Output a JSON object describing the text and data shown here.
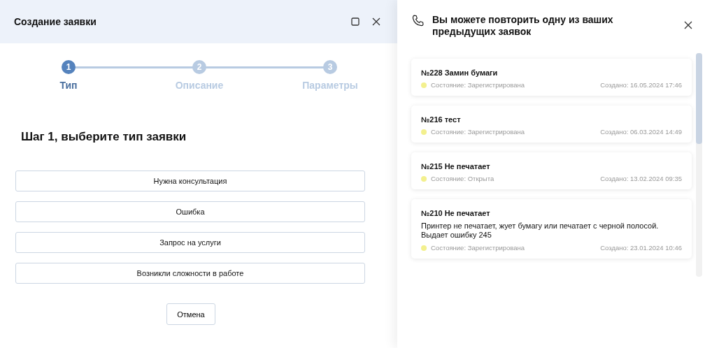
{
  "dialog": {
    "title": "Создание заявки"
  },
  "steps": [
    {
      "number": "1",
      "label": "Тип",
      "selected": true
    },
    {
      "number": "2",
      "label": "Описание",
      "selected": false
    },
    {
      "number": "3",
      "label": "Параметры",
      "selected": false
    }
  ],
  "heading": "Шаг 1, выберите тип заявки",
  "options": [
    "Нужна консультация",
    "Ошибка",
    "Запрос на услуги",
    "Возникли сложности в работе"
  ],
  "cancel": "Отмена",
  "panel": {
    "title": "Вы можете повторить одну из ваших предыдущих заявок",
    "requests": [
      {
        "title": "№228 Замин бумаги",
        "status": "Состояние: Зарегистрирована",
        "color": "#f3f08e",
        "created": "Создано: 16.05.2024 17:46"
      },
      {
        "title": "№216 тест",
        "status": "Состояние: Зарегистрирована",
        "color": "#f3f08e",
        "created": "Создано: 06.03.2024 14:49"
      },
      {
        "title": "№215 Не печатает",
        "status": "Состояние: Открыта",
        "color": "#f3f08e",
        "created": "Создано: 13.02.2024 09:35"
      },
      {
        "title": "№210 Не печатает",
        "description": "Принтер не печатает, жует бумагу или печатает с черной полосой. Выдает ошибку 245",
        "status": "Состояние: Зарегистрирована",
        "color": "#f3f08e",
        "created": "Создано: 23.01.2024 10:46"
      }
    ]
  }
}
